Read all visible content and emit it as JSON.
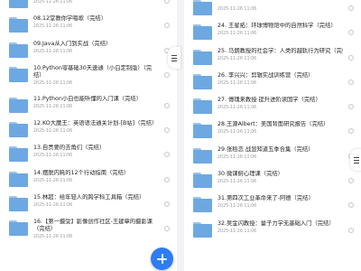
{
  "left_list": {
    "items": [
      {
        "title": "",
        "date": "2025-11-26 11:06"
      },
      {
        "title": "08.12堂教你学唱歌（完结）",
        "date": "2025-11-26 11:06"
      },
      {
        "title": "09.Java从入门到实战（完结）",
        "date": "2025-11-26 11:06"
      },
      {
        "title": "10.Python零基础30天速通（小白定制版）（完结）",
        "date": "2025-11-26 11:06",
        "tall": true
      },
      {
        "title": "11.Python小白也能听懂的入门课（完结）",
        "date": "2025-11-26 11:06"
      },
      {
        "title": "12.KO大魔王：英语语法通关计划-[B站]（完结）",
        "date": "2025-11-26 11:06"
      },
      {
        "title": "13.自责要的去角们（完结）",
        "date": "2025-11-26 11:06"
      },
      {
        "title": "14.摆脱内耗的12个行动指南（完结）",
        "date": "2025-11-26 11:06"
      },
      {
        "title": "15.林超：给年轻人的跨学科工具箱（完结）",
        "date": "2025-11-26 11:06"
      },
      {
        "title": "16.【第一摄受】影像创作社区-王建章的摄影课（完结）",
        "date": "2025-11-26 11:06",
        "tall": true
      }
    ]
  },
  "right_list": {
    "items": [
      {
        "title": "",
        "date": "2025-11-26 11:06"
      },
      {
        "title": "24. 王星拓：环球博物馆中的自然科学（完结）",
        "date": "2025-11-26 11:06"
      },
      {
        "title": "25. 马朗教授的社会学：人类的越轨行为研究（完结）",
        "date": "2025-11-26 11:06"
      },
      {
        "title": "26. 李兴兴：剪辑实战训练营（完结）",
        "date": "2025-11-26 11:06"
      },
      {
        "title": "27. 傅瑰来教授 提升进阶读国学（完结）",
        "date": "2025-11-26 11:06"
      },
      {
        "title": "28.王源Albert：美国背面研究报告（完结）",
        "date": "2025-11-26 11:06"
      },
      {
        "title": "29.张稻恋 战显知道五季合集（完结）",
        "date": "2025-11-26 11:06"
      },
      {
        "title": "30.微课俯心理课（完结）",
        "date": "2025-11-26 11:06"
      },
      {
        "title": "31.第四次工业革命来了-阿德（完结）",
        "date": "2025-11-26 11:06"
      },
      {
        "title": "32.吴金闪教授：量子力学无基础入门（完结）",
        "date": "2025-11-26 11:06"
      }
    ]
  },
  "fab": {
    "icon": "plus-icon",
    "color": "#2f7cf6"
  },
  "more_handle": {
    "icon": "menu-icon"
  }
}
